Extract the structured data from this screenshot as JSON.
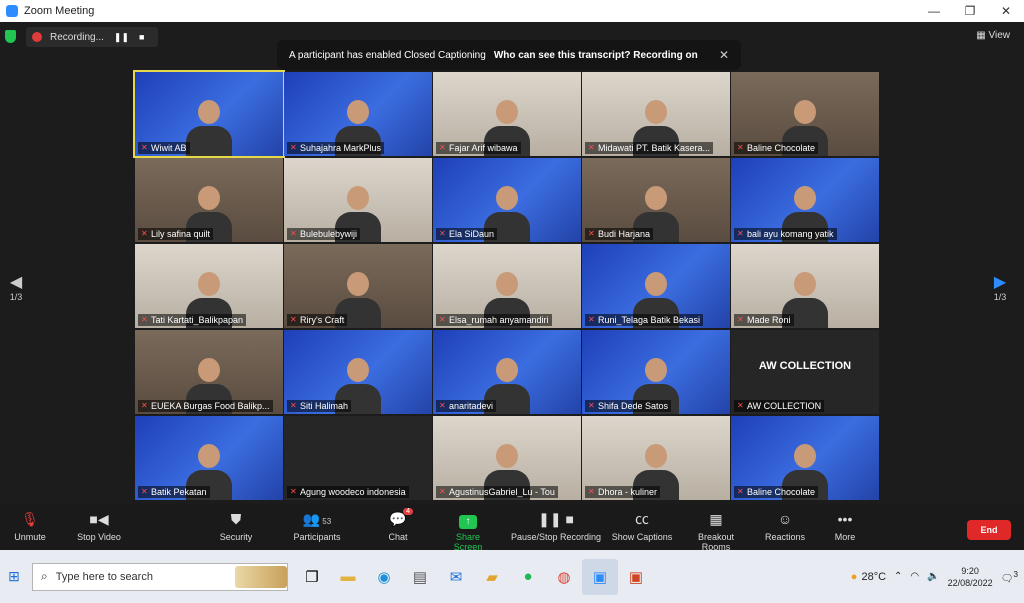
{
  "window": {
    "title": "Zoom Meeting",
    "min": "—",
    "max": "❐",
    "close": "✕"
  },
  "topbar": {
    "recording_label": "Recording...",
    "pause": "❚❚",
    "stop": "■",
    "view_label": "View",
    "banner_text": "A participant has enabled Closed Captioning",
    "banner_question": "Who can see this transcript? Recording on",
    "banner_close": "✕"
  },
  "pager": {
    "left_page": "1/3",
    "right_page": "1/3"
  },
  "participants": [
    {
      "name": "Wiwit AB",
      "bg": "blue",
      "active": true
    },
    {
      "name": "Suhajahra MarkPlus",
      "bg": "blue"
    },
    {
      "name": "Fajar Arif wibawa",
      "bg": "light"
    },
    {
      "name": "Midawati  PT. Batik Kasera...",
      "bg": "light"
    },
    {
      "name": "Baline Chocolate",
      "bg": "room"
    },
    {
      "name": "Lily safina quilt",
      "bg": "room"
    },
    {
      "name": "Bulebulebywiji",
      "bg": "light"
    },
    {
      "name": "Ela SiDaun",
      "bg": "blue"
    },
    {
      "name": "Budi Harjana",
      "bg": "room"
    },
    {
      "name": "bali ayu komang yatik",
      "bg": "blue"
    },
    {
      "name": "Tati Kartati_Balikpapan",
      "bg": "light"
    },
    {
      "name": "Riry's Craft",
      "bg": "room"
    },
    {
      "name": "Elsa_rumah anyamandiri",
      "bg": "light"
    },
    {
      "name": "Runi_Telaga Batik Bekasi",
      "bg": "blue"
    },
    {
      "name": "Made Roni",
      "bg": "light"
    },
    {
      "name": "EUEKA Burgas Food Balikp...",
      "bg": "room"
    },
    {
      "name": "Siti Halimah",
      "bg": "blue"
    },
    {
      "name": "anaritadevi",
      "bg": "blue"
    },
    {
      "name": "Shifa Dede Satos",
      "bg": "blue"
    },
    {
      "name": "AW COLLECTION",
      "bg": "dark",
      "text": "AW COLLECTION"
    },
    {
      "name": "Batik Pekatan",
      "bg": "blue"
    },
    {
      "name": "Agung woodeco indonesia",
      "bg": "dark"
    },
    {
      "name": "AgustinusGabriel_Lu - Tou",
      "bg": "light"
    },
    {
      "name": "Dhora - kuliner",
      "bg": "light"
    },
    {
      "name": "Baline Chocolate",
      "bg": "blue"
    }
  ],
  "toolbar": {
    "unmute": "Unmute",
    "stop_video": "Stop Video",
    "security": "Security",
    "participants": "Participants",
    "participants_count": "53",
    "chat": "Chat",
    "chat_badge": "4",
    "share_screen": "Share Screen",
    "pause_stop_recording": "Pause/Stop Recording",
    "show_captions": "Show Captions",
    "breakout_rooms": "Breakout Rooms",
    "reactions": "Reactions",
    "more": "More",
    "end": "End"
  },
  "taskbar": {
    "search_placeholder": "Type here to search",
    "temperature": "28°C",
    "time": "9:20",
    "date": "22/08/2022",
    "notification_count": "3"
  },
  "colors": {
    "accent": "#2d8cff",
    "end_red": "#e02828",
    "share_green": "#23c552",
    "active_speaker": "#e5d84a"
  }
}
